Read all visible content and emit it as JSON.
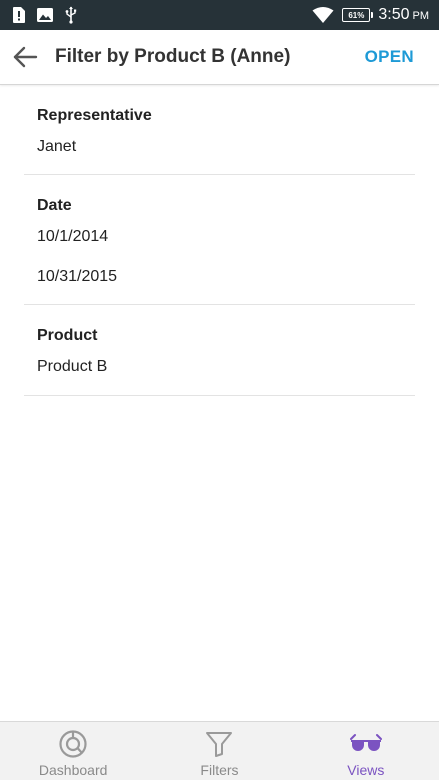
{
  "status_bar": {
    "time": "3:50",
    "ampm": "PM",
    "battery": "61%",
    "icons": [
      "alert-sim-icon",
      "image-icon",
      "usb-icon",
      "wifi-icon",
      "battery-icon"
    ]
  },
  "app_bar": {
    "title": "Filter by Product B (Anne)",
    "action_label": "OPEN",
    "accent_color": "#1e9ad6"
  },
  "filters": {
    "representative": {
      "header": "Representative",
      "values": [
        "Janet"
      ]
    },
    "date": {
      "header": "Date",
      "values": [
        "10/1/2014",
        "10/31/2015"
      ]
    },
    "product": {
      "header": "Product",
      "values": [
        "Product B"
      ]
    }
  },
  "bottom_nav": {
    "items": [
      {
        "label": "Dashboard",
        "icon": "dashboard-icon",
        "active": false
      },
      {
        "label": "Filters",
        "icon": "filter-icon",
        "active": false
      },
      {
        "label": "Views",
        "icon": "glasses-icon",
        "active": true
      }
    ],
    "active_color": "#7b53c1"
  }
}
